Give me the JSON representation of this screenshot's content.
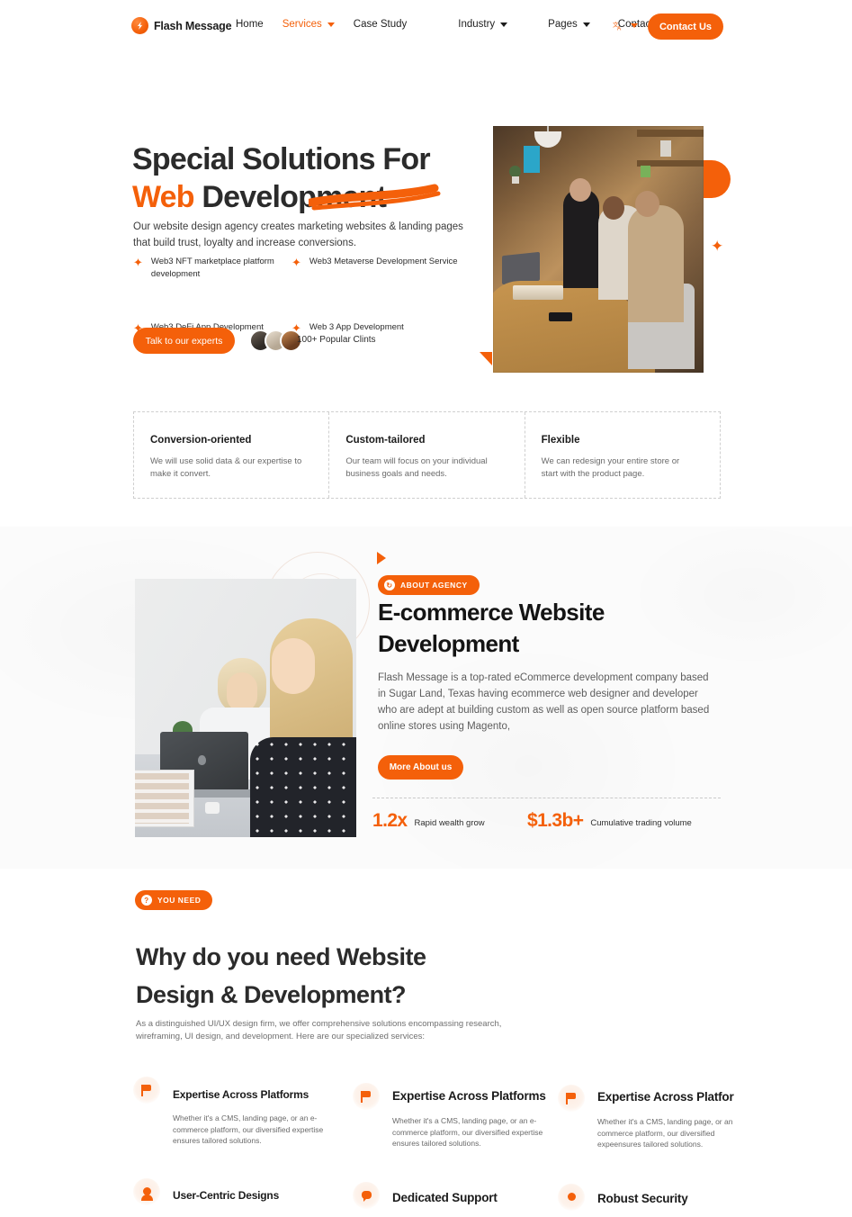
{
  "nav": {
    "brand": "Flash Message",
    "logo_icon": "flash-logo-icon",
    "links": [
      {
        "label": "Home",
        "has_caret": false,
        "active": false
      },
      {
        "label": "Services",
        "has_caret": true,
        "active": true
      },
      {
        "label": "Case Study",
        "has_caret": false,
        "active": false
      },
      {
        "label": "Industry",
        "has_caret": true,
        "active": false
      },
      {
        "label": "Pages",
        "has_caret": true,
        "active": false
      },
      {
        "label": "Contact",
        "has_caret": false,
        "active": false
      }
    ],
    "language_icon": "translate-icon",
    "cta_label": "Contact Us",
    "accent_color": "#f4600a"
  },
  "hero": {
    "title_line1": "Special Solutions For",
    "title_highlight": "Web",
    "title_line2_rest": " Development",
    "subtitle": "Our website design agency creates marketing websites & landing pages that build trust, loyalty and increase conversions.",
    "features": [
      "Web3 NFT marketplace platform development",
      "Web3 Metaverse Development Service",
      "Web3 DeFi App Development",
      "Web 3 App Development"
    ],
    "cta_label": "Talk to our experts",
    "clients_text": "100+ Popular Clints",
    "image_alt": "team-meeting-photo"
  },
  "cards": [
    {
      "title": "Conversion-oriented",
      "body": "We will use solid data & our expertise to make it convert."
    },
    {
      "title": "Custom-tailored",
      "body": "Our team will focus on your individual business goals and needs."
    },
    {
      "title": "Flexible",
      "body": "We can redesign your entire store or start with the product page."
    }
  ],
  "about": {
    "badge": "ABOUT AGENCY",
    "badge_icon": "refresh-icon",
    "heading": "E-commerce Website Development",
    "paragraph": "Flash Message is a top-rated eCommerce development company based in Sugar Land, Texas having ecommerce web designer and developer who are adept at building custom as well as open source platform based online stores using Magento,",
    "button": "More About us",
    "stats": [
      {
        "value": "1.2x",
        "label": "Rapid wealth grow"
      },
      {
        "value": "$1.3b+",
        "label": "Cumulative trading volume"
      }
    ],
    "image_alt": "two-women-laptop-photo"
  },
  "need": {
    "badge": "YOU NEED",
    "badge_icon": "question-icon",
    "heading_line1": "Why do you need Website",
    "heading_line2": "Design & Development?",
    "description": "As a distinguished UI/UX design firm, we offer comprehensive solutions encompassing research, wireframing, UI design, and development. Here are our specialized services:",
    "items": [
      {
        "icon": "flag-icon",
        "title": "Expertise Across Platforms",
        "body": "Whether it's a CMS, landing page, or an e-commerce platform, our diversified expertise ensures tailored solutions."
      },
      {
        "icon": "flag-icon",
        "title": "Expertise Across Platforms",
        "body": "Whether it's a CMS, landing page, or an e-commerce platform, our diversified expertise ensures tailored solutions."
      },
      {
        "icon": "flag-icon",
        "title": "Expertise Across Platfor",
        "body": "Whether it's a CMS, landing page, or an commerce platform, our diversified expeensures tailored solutions."
      },
      {
        "icon": "user-icon",
        "title": "User-Centric Designs",
        "body": ""
      },
      {
        "icon": "chat-icon",
        "title": "Dedicated Support",
        "body": ""
      },
      {
        "icon": "shield-dot-icon",
        "title": "Robust Security",
        "body": ""
      }
    ]
  }
}
